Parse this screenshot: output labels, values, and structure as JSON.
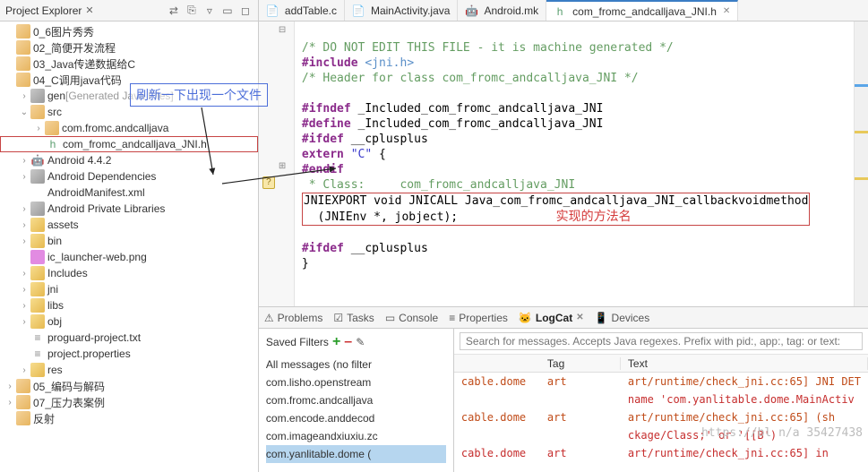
{
  "explorer": {
    "title": "Project Explorer",
    "tree": [
      {
        "indent": 1,
        "tw": "",
        "icon": "pkg",
        "label": "0_6图片秀秀",
        "type": "folder"
      },
      {
        "indent": 1,
        "tw": "",
        "icon": "pkg",
        "label": "02_简便开发流程",
        "type": "folder"
      },
      {
        "indent": 1,
        "tw": "",
        "icon": "pkg",
        "label": "03_Java传递数据给C",
        "type": "folder"
      },
      {
        "indent": 1,
        "tw": "",
        "icon": "pkg",
        "label": "04_C调用java代码",
        "type": "folder"
      },
      {
        "indent": 2,
        "tw": "›",
        "icon": "jar",
        "label": "gen",
        "decor": " [Generated Java Files]",
        "type": "folder"
      },
      {
        "indent": 2,
        "tw": "⌄",
        "icon": "pkg",
        "label": "src",
        "type": "folder"
      },
      {
        "indent": 3,
        "tw": "›",
        "icon": "pkg",
        "label": "com.fromc.andcalljava",
        "type": "package"
      },
      {
        "indent": 3,
        "tw": "",
        "icon": "hfile",
        "label": "com_fromc_andcalljava_JNI.h",
        "type": "file",
        "selected": true
      },
      {
        "indent": 2,
        "tw": "›",
        "icon": "android",
        "label": "Android 4.4.2",
        "type": "folder"
      },
      {
        "indent": 2,
        "tw": "›",
        "icon": "jar",
        "label": "Android Dependencies",
        "type": "folder"
      },
      {
        "indent": 2,
        "tw": "",
        "icon": "xml",
        "label": "AndroidManifest.xml",
        "type": "file"
      },
      {
        "indent": 2,
        "tw": "›",
        "icon": "jar",
        "label": "Android Private Libraries",
        "type": "folder"
      },
      {
        "indent": 2,
        "tw": "›",
        "icon": "folder",
        "label": "assets",
        "type": "folder"
      },
      {
        "indent": 2,
        "tw": "›",
        "icon": "folder",
        "label": "bin",
        "type": "folder"
      },
      {
        "indent": 2,
        "tw": "",
        "icon": "img",
        "label": "ic_launcher-web.png",
        "type": "file"
      },
      {
        "indent": 2,
        "tw": "›",
        "icon": "folder",
        "label": "Includes",
        "type": "folder"
      },
      {
        "indent": 2,
        "tw": "›",
        "icon": "folder",
        "label": "jni",
        "type": "folder"
      },
      {
        "indent": 2,
        "tw": "›",
        "icon": "folder",
        "label": "libs",
        "type": "folder"
      },
      {
        "indent": 2,
        "tw": "›",
        "icon": "folder",
        "label": "obj",
        "type": "folder"
      },
      {
        "indent": 2,
        "tw": "",
        "icon": "txt",
        "label": "proguard-project.txt",
        "type": "file"
      },
      {
        "indent": 2,
        "tw": "",
        "icon": "txt",
        "label": "project.properties",
        "type": "file"
      },
      {
        "indent": 2,
        "tw": "›",
        "icon": "folder",
        "label": "res",
        "type": "folder"
      },
      {
        "indent": 1,
        "tw": "›",
        "icon": "pkg",
        "label": "05_编码与解码",
        "type": "folder"
      },
      {
        "indent": 1,
        "tw": "›",
        "icon": "pkg",
        "label": "07_压力表案例",
        "type": "folder"
      },
      {
        "indent": 1,
        "tw": "",
        "icon": "pkg",
        "label": "反射",
        "type": "folder"
      }
    ]
  },
  "callouts": {
    "blue": "刷新一下出现一个文件",
    "red": "实现的方法名"
  },
  "editor": {
    "tabs": [
      {
        "icon": "file",
        "label": "addTable.c"
      },
      {
        "icon": "file",
        "label": "MainActivity.java"
      },
      {
        "icon": "android",
        "label": "Android.mk"
      },
      {
        "icon": "hfile",
        "label": "com_fromc_andcalljava_JNI.h",
        "active": true
      }
    ],
    "code": {
      "l1": "/* DO NOT EDIT THIS FILE - it is machine generated */",
      "l2a": "#include",
      "l2b": " <jni.h>",
      "l3": "/* Header for class com_fromc_andcalljava_JNI */",
      "l5a": "#ifndef",
      "l5b": " _Included_com_fromc_andcalljava_JNI",
      "l6a": "#define",
      "l6b": " _Included_com_fromc_andcalljava_JNI",
      "l7a": "#ifdef",
      "l7b": " __cplusplus",
      "l8a": "extern",
      "l8b": " \"C\"",
      "l8c": " {",
      "l9a": "#endif",
      "l10": " * Class:     com_fromc_andcalljava_JNI",
      "l11": "JNIEXPORT void JNICALL Java_com_fromc_andcalljava_JNI_callbackvoidmethod",
      "l12": "  (JNIEnv *, jobject);",
      "l14a": "#ifdef",
      "l14b": " __cplusplus",
      "l15": "}"
    }
  },
  "bottom": {
    "tabs": [
      "Problems",
      "Tasks",
      "Console",
      "Properties",
      "LogCat",
      "Devices"
    ],
    "activeTab": "LogCat",
    "filtersTitle": "Saved Filters",
    "filters": [
      "All messages (no filter",
      "com.lisho.openstream",
      "com.fromc.andcalljava",
      "com.encode.anddecod",
      "com.imageandxiuxiu.zc",
      "com.yanlitable.dome ("
    ],
    "searchPlaceholder": "Search for messages. Accepts Java regexes. Prefix with pid:, app:, tag: or text:",
    "columns": [
      "",
      "Tag",
      "Text"
    ],
    "rows": [
      {
        "a": "cable.dome",
        "tag": "art",
        "text": "art/runtime/check_jni.cc:65] JNI DET",
        "lev": "w"
      },
      {
        "a": "",
        "tag": "",
        "text": "name 'com.yanlitable.dome.MainActiv",
        "lev": "e"
      },
      {
        "a": "cable.dome",
        "tag": "art",
        "text": "art/runtime/check_jni.cc:65]     (sh",
        "lev": "w"
      },
      {
        "a": "",
        "tag": "",
        "text": "ckage/Class;' or '[[B')",
        "lev": "e"
      },
      {
        "a": "cable.dome",
        "tag": "art",
        "text": "art/runtime/check_jni.cc:65]     in",
        "lev": "e"
      }
    ]
  },
  "watermark": "https://bl              n/a      35427438"
}
